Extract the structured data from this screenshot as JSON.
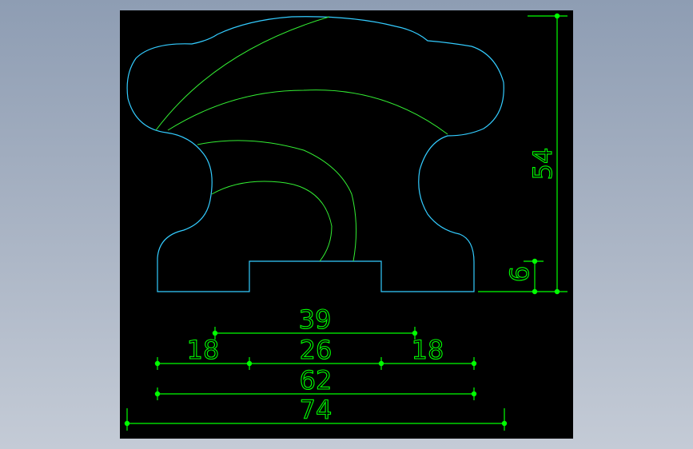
{
  "drawing": {
    "colors": {
      "background": "#000000",
      "outline": "#33ccff",
      "inner_lines": "#33ee33",
      "dimensions": "#00ff00"
    },
    "dimensions": {
      "total_height": "54",
      "base_step_height": "6",
      "top_width": "39",
      "left_step_width": "18",
      "slot_width": "26",
      "right_step_width": "18",
      "base_width": "62",
      "overall_width": "74"
    }
  }
}
